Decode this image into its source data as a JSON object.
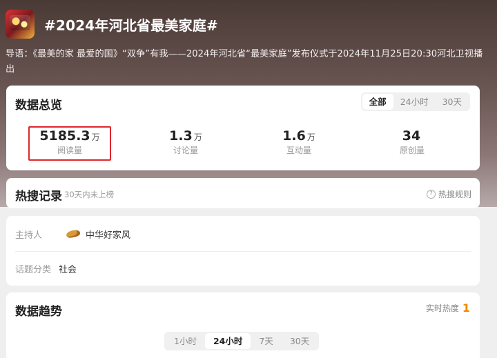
{
  "topic": {
    "title": "#2024年河北省最美家庭#",
    "intro": "导语：《最美的家 最爱的国》“双争”有我——2024年河北省“最美家庭”发布仪式于2024年11月25日20:30河北卫视播出"
  },
  "overview": {
    "title": "数据总览",
    "tabs": [
      "全部",
      "24小时",
      "30天"
    ],
    "active_tab": "全部",
    "stats": [
      {
        "num": "5185.3",
        "unit": "万",
        "label": "阅读量"
      },
      {
        "num": "1.3",
        "unit": "万",
        "label": "讨论量"
      },
      {
        "num": "1.6",
        "unit": "万",
        "label": "互动量"
      },
      {
        "num": "34",
        "unit": "",
        "label": "原创量"
      }
    ]
  },
  "hot_search": {
    "title": "热搜记录",
    "subtitle": "30天内未上榜",
    "rule_label": "热搜规则",
    "rule_icon": "?"
  },
  "info": {
    "host_key": "主持人",
    "host_value": "中华好家风",
    "category_key": "话题分类",
    "category_value": "社会"
  },
  "trend": {
    "title": "数据趋势",
    "realtime_label": "实时热度",
    "realtime_value": "1",
    "tabs": [
      "1小时",
      "24小时",
      "7天",
      "30天"
    ],
    "active_tab": "24小时"
  },
  "colors": {
    "highlight_box": "#e0262c",
    "realtime_accent": "#f08a00"
  }
}
